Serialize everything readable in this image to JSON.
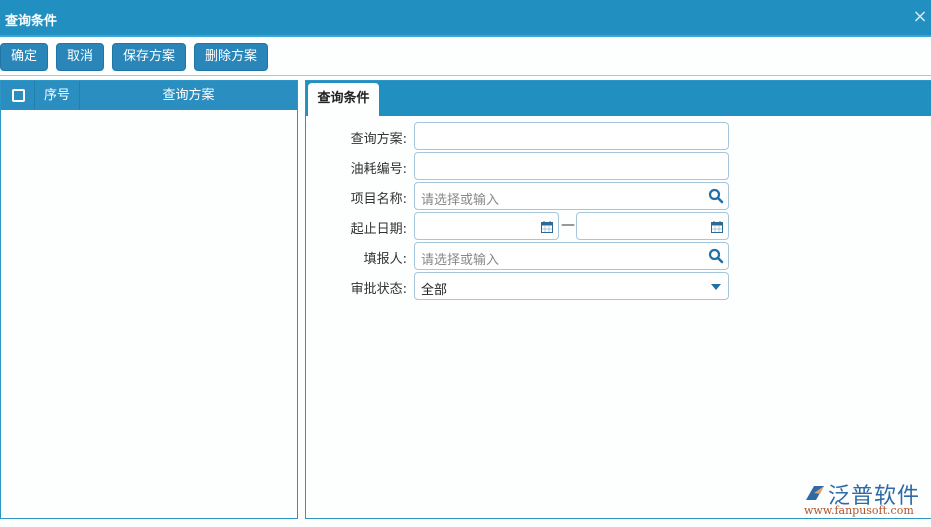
{
  "dialog": {
    "title": "查询条件",
    "close_icon": "×"
  },
  "toolbar": {
    "confirm_label": "确定",
    "cancel_label": "取消",
    "save_scheme_label": "保存方案",
    "delete_scheme_label": "删除方案"
  },
  "scheme_grid": {
    "columns": [
      "序号",
      "查询方案"
    ],
    "rows": []
  },
  "query_panel": {
    "tab_label": "查询条件",
    "fields": {
      "scheme": {
        "label": "查询方案:",
        "value": ""
      },
      "oil_code": {
        "label": "油耗编号:",
        "value": ""
      },
      "project": {
        "label": "项目名称:",
        "placeholder": "请选择或输入"
      },
      "date_range": {
        "label": "起止日期:",
        "start": "",
        "end": "",
        "separator": "—"
      },
      "reporter": {
        "label": "填报人:",
        "placeholder": "请选择或输入"
      },
      "approval_status": {
        "label": "审批状态:",
        "value": "全部"
      }
    }
  },
  "logo": {
    "name": "泛普软件",
    "url": "www.fanpusoft.com"
  },
  "colors": {
    "header_blue": "#2190c0",
    "button_blue": "#2a86b8",
    "border_blue": "#2d96c4",
    "input_border": "#a6c6dc"
  }
}
